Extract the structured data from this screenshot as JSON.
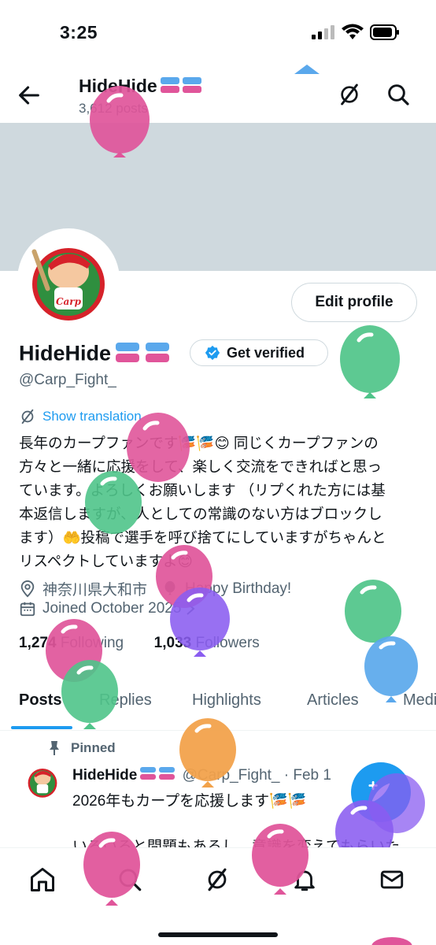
{
  "status": {
    "time": "3:25"
  },
  "header": {
    "name": "HideHide",
    "posts_count": "3,612 posts"
  },
  "profile": {
    "name": "HideHide",
    "handle": "@Carp_Fight_",
    "edit_label": "Edit profile",
    "verify_label": "Get verified",
    "translate_label": "Show translation",
    "bio_lines": [
      "長年のカープファンです🎏🎏😊 同じくカープファンの",
      "方々と一緒に応援をして、楽しく交流をできればと思っ",
      "ています。よろしくお願いします （リプくれた方には基",
      "本返信しますが、人としての常識のない方はブロックし",
      "ます）🤲投稿で選手を呼び捨てにしていますがちゃんと",
      "リスペクトしていますよ😊"
    ],
    "location": "神奈川県大和市",
    "birthday": "Happy Birthday!",
    "joined": "Joined October 2025",
    "following_count": "1,274",
    "following_label": "Following",
    "followers_count": "1,033",
    "followers_label": "Followers"
  },
  "tabs": [
    "Posts",
    "Replies",
    "Highlights",
    "Articles",
    "Media"
  ],
  "pinned_post": {
    "pinned_label": "Pinned",
    "author": "HideHide",
    "handle_date": "@Carp_Fight_ · Feb 1",
    "text_line1": "2026年もカープを応援します🎏🎏",
    "text_line2": "いろいろと問題もあるし、意識を変えてもらいた"
  },
  "colors": {
    "accent": "#1d9bf0",
    "balloon_pink": "#e0559a",
    "balloon_green": "#4fc489",
    "balloon_purple": "#8a5cf0",
    "balloon_blue": "#5aa8ec",
    "balloon_orange": "#f2a24a"
  }
}
